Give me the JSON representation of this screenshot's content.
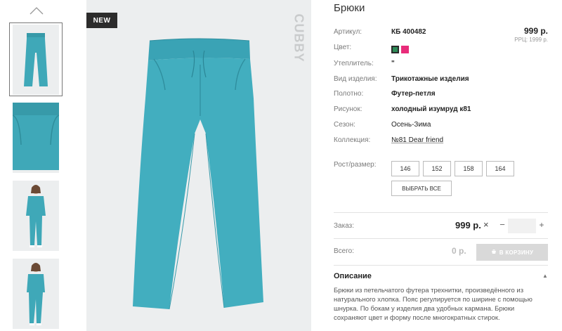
{
  "gallery": {
    "badge": "NEW",
    "brand": "CUBBY"
  },
  "product": {
    "title": "Брюки",
    "price": "999 р.",
    "rrp": "РРЦ: 1999 р.",
    "attributes": [
      {
        "label": "Артикул:",
        "value": "КБ 400482",
        "style": "bold"
      },
      {
        "label": "Цвет:",
        "value": "",
        "style": "bold"
      },
      {
        "label": "Утеплитель:",
        "value": "\"",
        "style": "bold"
      },
      {
        "label": "Вид изделия:",
        "value": "Трикотажные изделия",
        "style": "bold"
      },
      {
        "label": "Полотно:",
        "value": "Футер-петля",
        "style": "bold"
      },
      {
        "label": "Рисунок:",
        "value": "холодный изумруд к81",
        "style": "bold"
      },
      {
        "label": "Сезон:",
        "value": "Осень-Зима",
        "style": "normal"
      },
      {
        "label": "Коллекция:",
        "value": "№81 Dear friend",
        "style": "link"
      }
    ],
    "colors": [
      "#2e8b57",
      "#e82c7a"
    ]
  },
  "sizes": {
    "label": "Рост/размер:",
    "options": [
      "146",
      "152",
      "158",
      "164"
    ],
    "select_all": "ВЫБРАТЬ ВСЕ"
  },
  "order": {
    "label": "Заказ:",
    "price": "999 р.",
    "times": "×",
    "minus": "−",
    "qty_value": "",
    "plus": "+"
  },
  "total": {
    "label": "Всего:",
    "value": "0 р.",
    "cart_button": "В КОРЗИНУ"
  },
  "description": {
    "title": "Описание",
    "toggle": "▲",
    "text": "Брюки из петельчатого футера трехнитки, произведённого из натурального хлопка. Пояс регулируется по ширине с помощью шнурка. По бокам у изделия два удобных кармана. Брюки сохраняют цвет и форму после многократных стирок."
  }
}
